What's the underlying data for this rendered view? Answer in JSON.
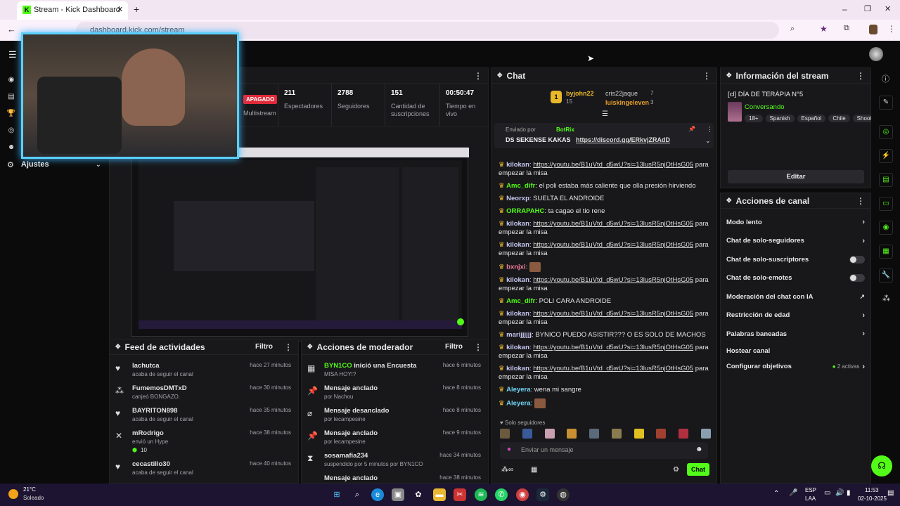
{
  "browser": {
    "tab_title": "Stream - Kick Dashboard",
    "new_tab": "+",
    "url": "dashboard.kick.com/stream",
    "window_controls": [
      "–",
      "❐",
      "✕"
    ]
  },
  "sidebar": {
    "ajustes_label": "Ajustes"
  },
  "stream_stats": {
    "status": "APAGADO",
    "status_sub": "Multistream",
    "items": [
      {
        "value": "211",
        "label": "Espectadores"
      },
      {
        "value": "2788",
        "label": "Seguidores"
      },
      {
        "value": "151",
        "label": "Cantidad de suscripciones"
      },
      {
        "value": "00:50:47",
        "label": "Tiempo en vivo"
      }
    ]
  },
  "chat": {
    "title": "Chat",
    "leaderboard": [
      {
        "name": "byjohn22",
        "count": "15"
      },
      {
        "name": "cris22jaque",
        "count": "7"
      },
      {
        "name": "luiskingeleven",
        "count": "3"
      }
    ],
    "pinned_by_label": "Enviado por",
    "pinned_by": "BotRix",
    "pinned_text": "DS SEKENSE KAKAS",
    "pinned_link": "https://discord.gg/ERkvjZRAdD",
    "messages": [
      {
        "user": "kilokan",
        "color": "#c9c9f5",
        "link": "https://youtu.be/B1uVtd_d5wU?si=13lusR5njOtHsG05",
        "text": "para empezar la misa"
      },
      {
        "user": "Amc_difr",
        "color": "#53fc18",
        "link": "",
        "text": "el poli estaba más caliente que olla presión hirviendo"
      },
      {
        "user": "Neorxp",
        "color": "#c9c9f5",
        "link": "",
        "text": "SUELTA EL ANDROIDE"
      },
      {
        "user": "ORRAPAHC",
        "color": "#53fc18",
        "link": "",
        "text": "ta cagao el tio rene"
      },
      {
        "user": "kilokan",
        "color": "#c9c9f5",
        "link": "https://youtu.be/B1uVtd_d5wU?si=13lusR5njOtHsG05",
        "text": "para empezar la misa"
      },
      {
        "user": "kilokan",
        "color": "#c9c9f5",
        "link": "https://youtu.be/B1uVtd_d5wU?si=13lusR5njOtHsG05",
        "text": "para empezar la misa"
      },
      {
        "user": "bxnjxi",
        "color": "#f57f9c",
        "link": "",
        "text": ""
      },
      {
        "user": "kilokan",
        "color": "#c9c9f5",
        "link": "https://youtu.be/B1uVtd_d5wU?si=13lusR5njOtHsG05",
        "text": "para empezar la misa"
      },
      {
        "user": "Amc_difr",
        "color": "#53fc18",
        "link": "",
        "text": "POLI CARA ANDROIDE"
      },
      {
        "user": "kilokan",
        "color": "#c9c9f5",
        "link": "https://youtu.be/B1uVtd_d5wU?si=13lusR5njOtHsG05",
        "text": "para empezar la misa"
      },
      {
        "user": "marijjjjjj",
        "color": "#c9c9f5",
        "link": "",
        "text": "BYNICO PUEDO ASISTIR??? O ES SOLO DE MACHOS"
      },
      {
        "user": "kilokan",
        "color": "#c9c9f5",
        "link": "https://youtu.be/B1uVtd_d5wU?si=13lusR5njOtHsG05",
        "text": "para empezar la misa"
      },
      {
        "user": "kilokan",
        "color": "#c9c9f5",
        "link": "https://youtu.be/B1uVtd_d5wU?si=13lusR5njOtHsG05",
        "text": "para empezar la misa"
      },
      {
        "user": "Aleyera",
        "color": "#6fd6f7",
        "link": "",
        "text": "wena mi sangre"
      },
      {
        "user": "Aleyera",
        "color": "#6fd6f7",
        "link": "",
        "text": ""
      }
    ],
    "followers_only": "Solo seguidores",
    "input_placeholder": "Enviar un mensaje",
    "send_label": "Chat"
  },
  "stream_info": {
    "title": "Información del stream",
    "stream_title": "[cl] DÍA DE TERÁPIA N°5",
    "category": "Conversando",
    "tags": [
      "18+",
      "Spanish",
      "Español",
      "Chile",
      "Shoote"
    ],
    "edit_label": "Editar"
  },
  "channel_actions": {
    "title": "Acciones de canal",
    "items": [
      {
        "label": "Modo lento",
        "control": "›"
      },
      {
        "label": "Chat de solo-seguidores",
        "control": "›"
      },
      {
        "label": "Chat de solo-suscriptores",
        "control": "toggle"
      },
      {
        "label": "Chat de solo-emotes",
        "control": "toggle"
      },
      {
        "label": "Moderación del chat con IA",
        "control": "↗"
      },
      {
        "label": "Restricción de edad",
        "control": "›"
      },
      {
        "label": "Palabras baneadas",
        "control": "›"
      },
      {
        "label": "Hostear canal",
        "control": ""
      },
      {
        "label": "Configurar objetivos",
        "control": "›"
      }
    ],
    "goals_badge": "2 activas"
  },
  "activity_feed": {
    "title": "Feed de actividades",
    "filter": "Filtro",
    "items": [
      {
        "icon": "♥",
        "name": "lachutca",
        "desc": "acaba de seguir el canal",
        "time": "hace 27 minutos"
      },
      {
        "icon": "⁂",
        "name": "FumemosDMTxD",
        "desc": "canjeó BONGAZO.",
        "time": "hace 30 minutos"
      },
      {
        "icon": "♥",
        "name": "BAYRITON898",
        "desc": "acaba de seguir el canal",
        "time": "hace 35 minutos"
      },
      {
        "icon": "✕",
        "name": "mRodrigo",
        "desc": "envió un Hype",
        "extra": "10",
        "time": "hace 38 minutos"
      },
      {
        "icon": "♥",
        "name": "cecastillo30",
        "desc": "acaba de seguir el canal",
        "time": "hace 40 minutos"
      }
    ]
  },
  "mod_actions": {
    "title": "Acciones de moderador",
    "filter": "Filtro",
    "items": [
      {
        "icon": "▦",
        "name": "BYN1CO",
        "action": "inició una Encuesta",
        "sub": "MISA HOY!?",
        "time": "hace 6 minutos"
      },
      {
        "icon": "📌",
        "name": "Mensaje anclado",
        "action": "",
        "sub": "por Nachou",
        "time": "hace 8 minutos"
      },
      {
        "icon": "⌀",
        "name": "Mensaje desanclado",
        "action": "",
        "sub": "por lecampesine",
        "time": "hace 8 minutos"
      },
      {
        "icon": "📌",
        "name": "Mensaje anclado",
        "action": "",
        "sub": "por lecampesine",
        "time": "hace 9 minutos"
      },
      {
        "icon": "⧗",
        "name": "sosamafia234",
        "action": "",
        "sub": "suspendido por 5 minutos por BYN1CO",
        "time": "hace 34 minutos"
      },
      {
        "icon": "",
        "name": "Mensaje anclado",
        "action": "",
        "sub": "",
        "time": "hace 38 minutos"
      }
    ]
  },
  "taskbar": {
    "weather_temp": "21°C",
    "weather_desc": "Soleado",
    "lang1": "ESP",
    "lang2": "LAA",
    "time": "11:53",
    "date": "02-10-2025"
  },
  "colors": {
    "accent": "#53fc18",
    "panel": "#18181b",
    "bg": "#0b0b0c"
  }
}
